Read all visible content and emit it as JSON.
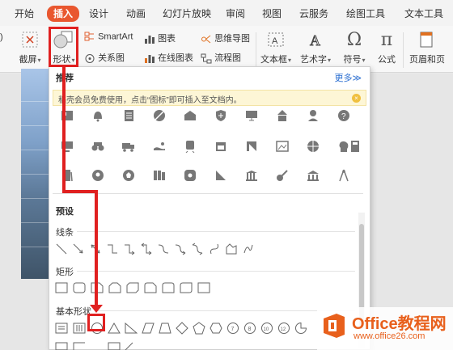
{
  "ribbon": {
    "tabs": [
      {
        "label": "开始"
      },
      {
        "label": "插入"
      },
      {
        "label": "设计"
      },
      {
        "label": "动画"
      },
      {
        "label": "幻灯片放映"
      },
      {
        "label": "审阅"
      },
      {
        "label": "视图"
      },
      {
        "label": "云服务"
      },
      {
        "label": "绘图工具"
      },
      {
        "label": "文本工具"
      }
    ],
    "active_tab": "插入"
  },
  "toolbar": {
    "screenshot_label": "截屏",
    "shapes_label": "形状",
    "smartart_label": "SmartArt",
    "relation_label": "关系图",
    "chart_label": "图表",
    "online_chart_label": "在线图表",
    "mindmap_label": "思维导图",
    "flowchart_label": "流程图",
    "textbox_label": "文本框",
    "wordart_label": "艺术字",
    "symbol_label": "符号",
    "formula_label": "公式",
    "header_label": "页眉和页"
  },
  "panel": {
    "recommended_title": "推荐",
    "more_link": "更多≫",
    "notice": "稻壳会员免费使用，点击“图标”即可插入至文档内。",
    "preset_title": "预设",
    "groups": {
      "lines": "线条",
      "rectangles": "矩形",
      "basic_shapes": "基本形状"
    }
  },
  "watermark": {
    "title": "Office教程网",
    "url": "www.office26.com"
  },
  "colors": {
    "accent_tab": "#e9572f",
    "highlight_red": "#e02020",
    "watermark_orange": "#e8601c",
    "link_blue": "#2c6fd1"
  }
}
